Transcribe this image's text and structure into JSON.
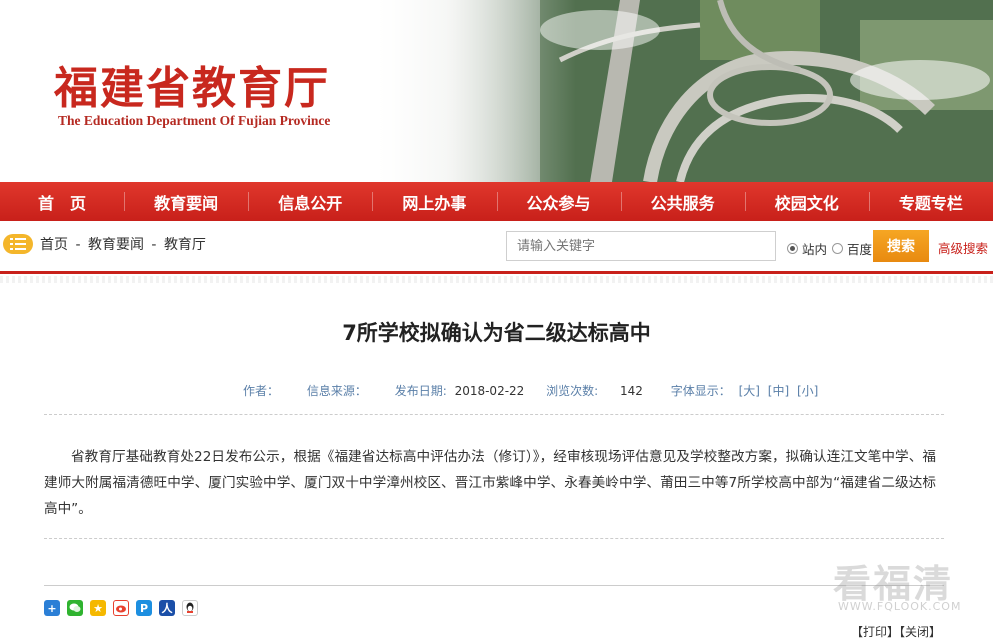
{
  "header": {
    "title_cn": "福建省教育厅",
    "title_en": "The Education Department Of Fujian Province"
  },
  "nav": {
    "items": [
      "首　页",
      "教育要闻",
      "信息公开",
      "网上办事",
      "公众参与",
      "公共服务",
      "校园文化",
      "专题专栏"
    ]
  },
  "breadcrumb": {
    "items": [
      "首页",
      "-",
      "教育要闻",
      "-",
      "教育厅"
    ]
  },
  "search": {
    "placeholder": "请输入关键字",
    "options": [
      "站内",
      "百度"
    ],
    "selected": "站内",
    "button_label": "搜索",
    "advanced_label": "高级搜索"
  },
  "article": {
    "title": "7所学校拟确认为省二级达标高中",
    "meta": {
      "author_label": "作者：",
      "source_label": "信息来源：",
      "date_label": "发布日期:",
      "date_value": "2018-02-22",
      "views_label": "浏览次数:",
      "views_value": "142",
      "font_label": "字体显示：",
      "font_large": "[大]",
      "font_medium": "[中]",
      "font_small": "[小]"
    },
    "body": "省教育厅基础教育处22日发布公示，根据《福建省达标高中评估办法（修订）》，经审核现场评估意见及学校整改方案，拟确认连江文笔中学、福建师大附属福清德旺中学、厦门实验中学、厦门双十中学漳州校区、晋江市紫峰中学、永春美岭中学、莆田三中等7所学校高中部为“福建省二级达标高中”。"
  },
  "share": {
    "icons": [
      "share-more-icon",
      "wechat-icon",
      "qzone-icon",
      "weibo-icon",
      "tencent-weibo-icon",
      "renren-icon",
      "qq-icon"
    ],
    "colors": [
      "#2b7fd6",
      "#2fb32f",
      "#f5b800",
      "#e8412f",
      "#1d8fe0",
      "#1b4fa8",
      "#2b7fd6"
    ]
  },
  "footer": {
    "print_label": "【打印】",
    "close_label": "【关闭】"
  },
  "watermark": {
    "main": "看福清",
    "sub": "WWW.FQLOOK.COM"
  },
  "colors": {
    "brand_red": "#c8201a",
    "search_orange": "#f6a623",
    "meta_blue": "#5a7fa8"
  }
}
